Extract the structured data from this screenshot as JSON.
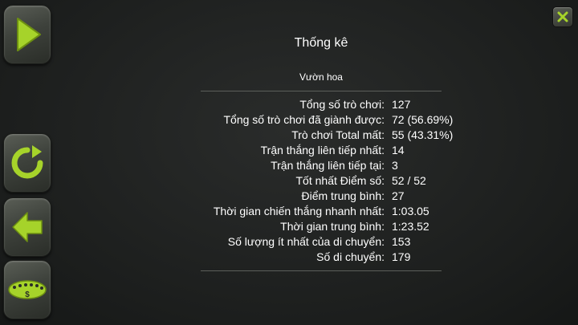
{
  "dialog": {
    "title": "Thống kê",
    "subtitle": "Vườn hoa"
  },
  "stats": [
    {
      "label": "Tổng số trò chơi:",
      "value": "127"
    },
    {
      "label": "Tổng số trò chơi đã giành được:",
      "value": "72 (56.69%)"
    },
    {
      "label": "Trò chơi Total mất:",
      "value": "55 (43.31%)"
    },
    {
      "label": "Trận thắng liên tiếp nhất:",
      "value": "14"
    },
    {
      "label": "Trận thắng liên tiếp tại:",
      "value": "3"
    },
    {
      "label": "Tốt nhất Điểm số:",
      "value": "52 / 52"
    },
    {
      "label": "Điểm trung bình:",
      "value": "27"
    },
    {
      "label": "Thời gian chiến thắng nhanh nhất:",
      "value": "1:03.05"
    },
    {
      "label": "Thời gian trung bình:",
      "value": "1:23.52"
    },
    {
      "label": "Số lượng ít nhất của di chuyển:",
      "value": "153"
    },
    {
      "label": "Số di chuyển:",
      "value": "179"
    }
  ],
  "sidebar": {
    "icons": [
      "play-icon",
      "restart-icon",
      "back-arrow-icon",
      "vegas-icon"
    ]
  },
  "colors": {
    "accent": "#a6d32a",
    "background": "#1f2120",
    "text": "#ffffff"
  }
}
